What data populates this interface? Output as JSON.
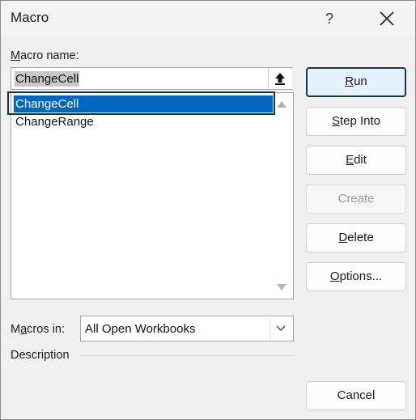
{
  "window": {
    "title": "Macro",
    "help": "?"
  },
  "macro_name": {
    "label_ul": "M",
    "label_rest": "acro name:",
    "value": "ChangeCell"
  },
  "macros": [
    {
      "name": "ChangeCell",
      "selected": true
    },
    {
      "name": "ChangeRange",
      "selected": false
    }
  ],
  "buttons": {
    "run": {
      "ul": "R",
      "rest": "un"
    },
    "step_into": {
      "ul": "S",
      "rest": "tep Into"
    },
    "edit": {
      "ul": "E",
      "rest": "dit"
    },
    "create": {
      "label": "Create"
    },
    "delete": {
      "ul": "D",
      "rest": "elete"
    },
    "options": {
      "ul": "O",
      "rest": "ptions..."
    },
    "cancel": {
      "label": "Cancel"
    }
  },
  "macros_in": {
    "label_pre": "M",
    "label_ul": "a",
    "label_rest": "cros in:",
    "value": "All Open Workbooks"
  },
  "description": {
    "label": "Description"
  },
  "colors": {
    "selection": "#0067c0",
    "focus": "#0f3a45",
    "default_button": "#e5f1fb"
  }
}
